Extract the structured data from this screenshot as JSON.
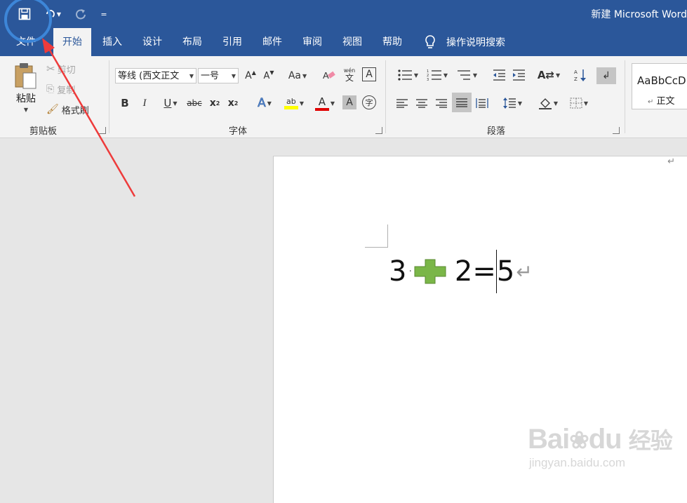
{
  "titlebar": {
    "title": "新建 Microsoft Word",
    "customize_label": "="
  },
  "tabs": [
    {
      "label": "文件"
    },
    {
      "label": "开始"
    },
    {
      "label": "插入"
    },
    {
      "label": "设计"
    },
    {
      "label": "布局"
    },
    {
      "label": "引用"
    },
    {
      "label": "邮件"
    },
    {
      "label": "审阅"
    },
    {
      "label": "视图"
    },
    {
      "label": "帮助"
    }
  ],
  "tell_me": "操作说明搜索",
  "clipboard": {
    "group_label": "剪贴板",
    "paste": "粘贴",
    "cut": "剪切",
    "copy": "复制",
    "format_painter": "格式刷"
  },
  "font": {
    "group_label": "字体",
    "font_name": "等线 (西文正文",
    "font_size": "一号",
    "grow": "A",
    "shrink": "A",
    "change_case": "Aa",
    "phonetic_top": "wén",
    "phonetic_bottom": "文",
    "border_char": "A",
    "bold": "B",
    "italic": "I",
    "underline": "U",
    "strike": "abc",
    "subscript": "x",
    "superscript": "x",
    "subscript_mark": "2",
    "superscript_mark": "2",
    "text_effect": "A",
    "highlight": "ab",
    "font_color": "A",
    "char_shading": "A",
    "enclose_char": "字"
  },
  "paragraph": {
    "group_label": "段落"
  },
  "styles": {
    "sample": "AaBbCcD",
    "name": "正文",
    "mark": "↵"
  },
  "document": {
    "num1": "3",
    "dot": "·",
    "num2": "2",
    "equals": "=",
    "result": "5",
    "para_mark": "↵",
    "top_mark": "↵"
  },
  "watermark": {
    "brand": "Bai",
    "brand2": "du",
    "product": "经验",
    "url": "jingyan.baidu.com"
  },
  "colors": {
    "brand_blue": "#2b579a",
    "highlight_yellow": "#ffff00",
    "font_red": "#e00000",
    "plus_green": "#7ab648",
    "annotation_blue": "#3d86d8",
    "arrow_red": "#ee3b3b"
  }
}
